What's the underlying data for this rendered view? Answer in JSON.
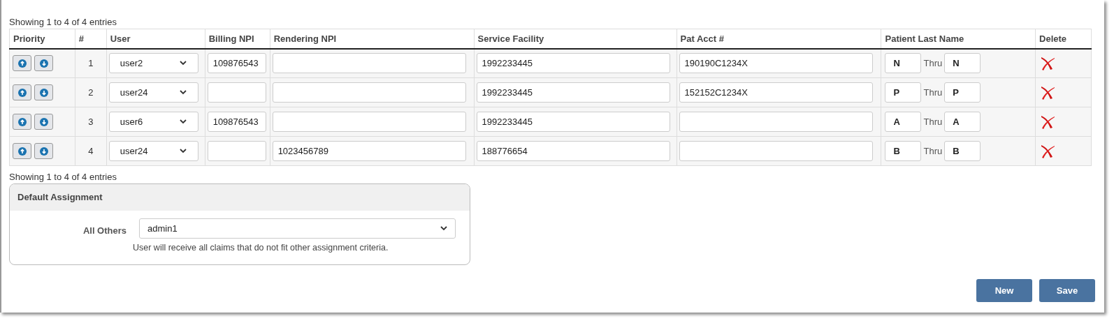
{
  "table": {
    "info_top": "Showing 1 to 4 of 4 entries",
    "columns": [
      "Priority",
      "#",
      "User",
      "Billing NPI",
      "Rendering NPI",
      "Service Facility",
      "Pat Acct #",
      "Patient Last Name",
      "Delete"
    ],
    "rows": [
      {
        "number": "1",
        "user": "user2",
        "billing_npi": "109876543",
        "rendering_npi": "",
        "service_facility": "1992233445",
        "pat_acct": "190190C1234X",
        "last_name_from": "N",
        "thru": "Thru",
        "last_name_to": "N"
      },
      {
        "number": "2",
        "user": "user24",
        "billing_npi": "",
        "rendering_npi": "",
        "service_facility": "1992233445",
        "pat_acct": "152152C1234X",
        "last_name_from": "P",
        "thru": "Thru",
        "last_name_to": "P"
      },
      {
        "number": "3",
        "user": "user6",
        "billing_npi": "109876543",
        "rendering_npi": "",
        "service_facility": "1992233445",
        "pat_acct": "",
        "last_name_from": "A",
        "thru": "Thru",
        "last_name_to": "A"
      },
      {
        "number": "4",
        "user": "user24",
        "billing_npi": "",
        "rendering_npi": "1023456789",
        "service_facility": "188776654",
        "pat_acct": "",
        "last_name_from": "B",
        "thru": "Thru",
        "last_name_to": "B"
      }
    ],
    "info_bottom": "Showing 1 to 4 of 4 entries"
  },
  "default_assignment": {
    "title": "Default Assignment",
    "label": "All Others",
    "value": "admin1",
    "help": "User will receive all claims that do not fit other assignment criteria."
  },
  "buttons": [
    "New",
    "Save"
  ]
}
